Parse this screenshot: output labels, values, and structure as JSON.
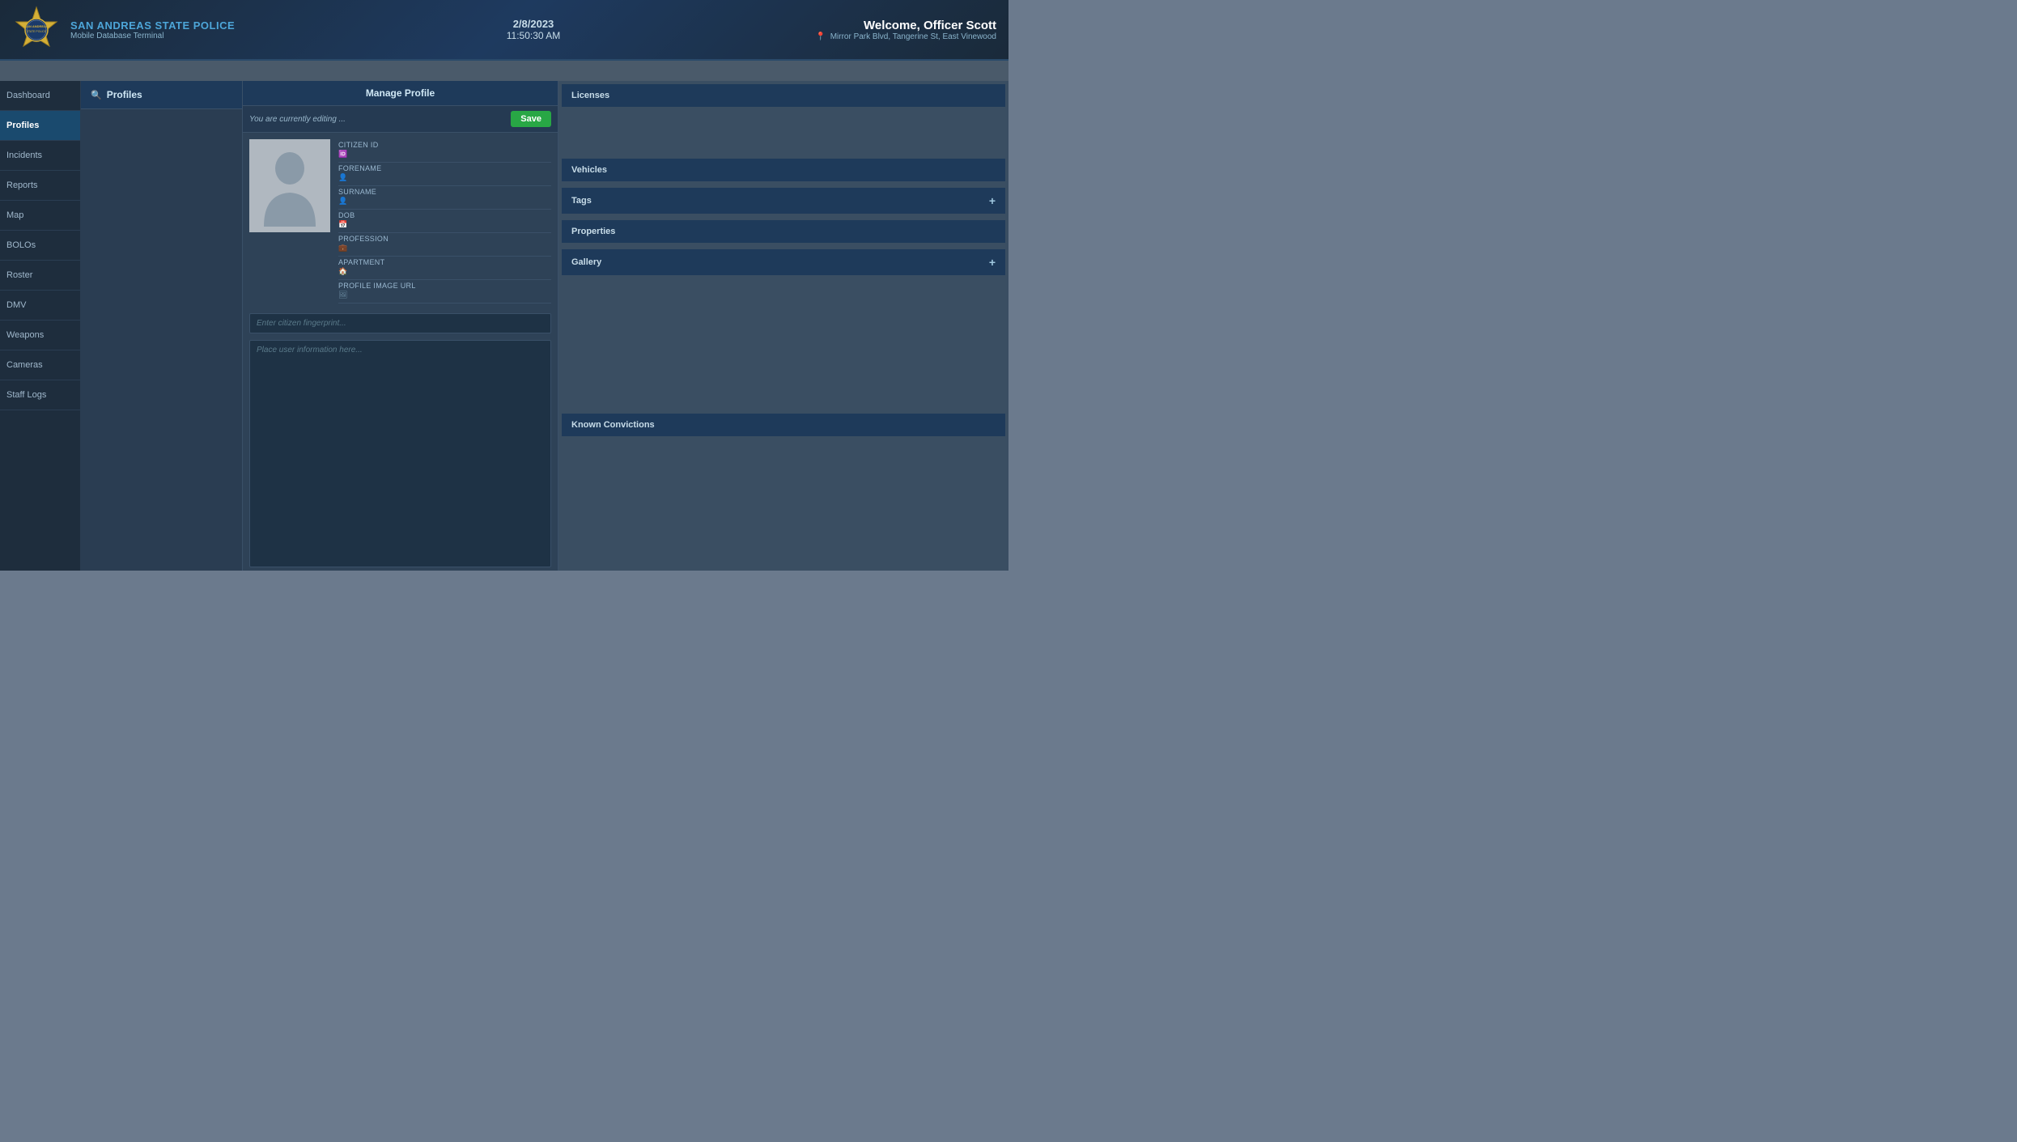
{
  "header": {
    "badge_alt": "San Andreas State Police Badge",
    "org_name": "SAN ANDREAS STATE POLICE",
    "sub_title": "Mobile Database Terminal",
    "date": "2/8/2023",
    "time": "11:50:30 AM",
    "welcome": "Welcome, Officer Scott",
    "location": "Mirror Park Blvd, Tangerine St, East Vinewood",
    "pin_icon": "📍"
  },
  "sidebar": {
    "items": [
      {
        "id": "dashboard",
        "label": "Dashboard",
        "active": false
      },
      {
        "id": "profiles",
        "label": "Profiles",
        "active": true
      },
      {
        "id": "incidents",
        "label": "Incidents",
        "active": false
      },
      {
        "id": "reports",
        "label": "Reports",
        "active": false
      },
      {
        "id": "map",
        "label": "Map",
        "active": false
      },
      {
        "id": "bolos",
        "label": "BOLOs",
        "active": false
      },
      {
        "id": "roster",
        "label": "Roster",
        "active": false
      },
      {
        "id": "dmv",
        "label": "DMV",
        "active": false
      },
      {
        "id": "weapons",
        "label": "Weapons",
        "active": false
      },
      {
        "id": "cameras",
        "label": "Cameras",
        "active": false
      },
      {
        "id": "staff_logs",
        "label": "Staff Logs",
        "active": false
      }
    ]
  },
  "profiles_panel": {
    "header": "Profiles",
    "search_icon": "🔍"
  },
  "manage_panel": {
    "header": "Manage Profile",
    "editing_text": "You are currently editing ...",
    "save_label": "Save",
    "fields": [
      {
        "id": "citizen_id",
        "label": "Citizen ID",
        "icon": "🆔"
      },
      {
        "id": "forename",
        "label": "Forename",
        "icon": "👤"
      },
      {
        "id": "surname",
        "label": "Surname",
        "icon": "👤"
      },
      {
        "id": "dob",
        "label": "DOB",
        "icon": "📅"
      },
      {
        "id": "profession",
        "label": "Profession",
        "icon": "💼"
      },
      {
        "id": "apartment",
        "label": "Apartment",
        "icon": "🏠"
      },
      {
        "id": "profile_image_url",
        "label": "Profile Image URL",
        "icon": "🖼"
      }
    ],
    "fingerprint_placeholder": "Enter citizen fingerprint...",
    "info_placeholder": "Place user information here..."
  },
  "right_panel": {
    "sections": [
      {
        "id": "licenses",
        "label": "Licenses",
        "has_plus": false
      },
      {
        "id": "vehicles",
        "label": "Vehicles",
        "has_plus": false
      },
      {
        "id": "tags",
        "label": "Tags",
        "has_plus": true
      },
      {
        "id": "properties",
        "label": "Properties",
        "has_plus": false
      },
      {
        "id": "gallery",
        "label": "Gallery",
        "has_plus": true
      }
    ],
    "known_convictions": "Known Convictions"
  }
}
